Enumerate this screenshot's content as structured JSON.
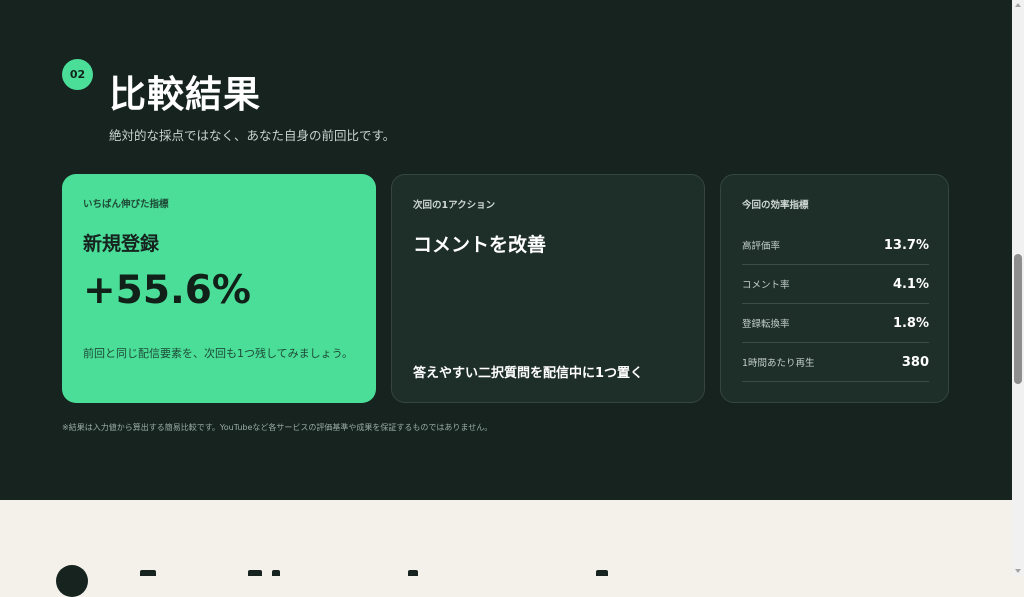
{
  "section": {
    "number": "02",
    "title": "比較結果",
    "subtitle": "絶対的な採点ではなく、あなた自身の前回比です。"
  },
  "best_card": {
    "label": "いちばん伸びた指標",
    "metric": "新規登録",
    "change": "+55.6%",
    "note": "前回と同じ配信要素を、次回も1つ残してみましょう。"
  },
  "action_card": {
    "label": "次回の1アクション",
    "headline": "コメントを改善",
    "action": "答えやすい二択質問を配信中に1つ置く"
  },
  "efficiency_card": {
    "label": "今回の効率指標",
    "rows": [
      {
        "label": "高評価率",
        "value": "13.7%"
      },
      {
        "label": "コメント率",
        "value": "4.1%"
      },
      {
        "label": "登録転換率",
        "value": "1.8%"
      },
      {
        "label": "1時間あたり再生",
        "value": "380"
      }
    ]
  },
  "disclaimer": "※結果は入力値から算出する簡易比較です。YouTubeなど各サービスの評価基準や成果を保証するものではありません。",
  "colors": {
    "background_dark": "#16231f",
    "accent_green": "#4ade98",
    "card_dark": "#1e2e29",
    "page_light": "#f4f1ea"
  }
}
